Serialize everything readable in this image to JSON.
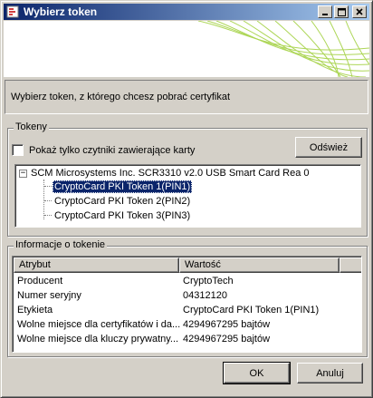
{
  "window": {
    "title": "Wybierz token"
  },
  "description": "Wybierz token, z którego chcesz pobrać certyfikat",
  "tokens_group": {
    "label": "Tokeny",
    "checkbox_label": "Pokaż tylko czytniki zawierające karty",
    "checkbox_checked": false,
    "refresh_label": "Odśwież",
    "tree": {
      "root": "SCM Microsystems Inc. SCR3310 v2.0 USB Smart Card Rea 0",
      "expander": "−",
      "children": [
        "CryptoCard PKI Token 1(PIN1)",
        "CryptoCard PKI Token 2(PIN2)",
        "CryptoCard PKI Token 3(PIN3)"
      ],
      "selected_index": 0
    }
  },
  "info_group": {
    "label": "Informacje o tokenie",
    "columns": [
      "Atrybut",
      "Wartość"
    ],
    "rows": [
      {
        "attr": "Producent",
        "value": "CryptoTech"
      },
      {
        "attr": "Numer seryjny",
        "value": "04312120"
      },
      {
        "attr": "Etykieta",
        "value": "CryptoCard PKI Token 1(PIN1)"
      },
      {
        "attr": "Wolne miejsce dla certyfikatów i da...",
        "value": "4294967295 bajtów"
      },
      {
        "attr": "Wolne miejsce dla kluczy prywatny...",
        "value": "4294967295 bajtów"
      }
    ]
  },
  "buttons": {
    "ok": "OK",
    "cancel": "Anuluj"
  },
  "colors": {
    "titlebar_start": "#0a246a",
    "titlebar_end": "#a6caf0",
    "selection": "#0a246a",
    "banner_swirl": "#9fcf3a"
  }
}
